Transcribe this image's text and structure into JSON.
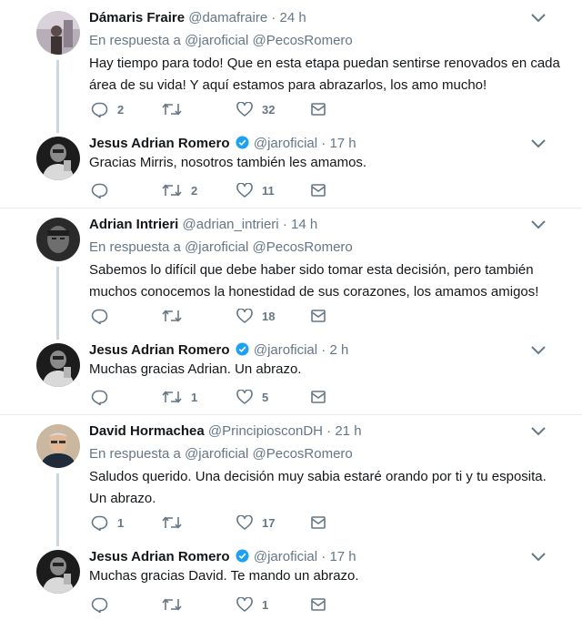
{
  "icons": {
    "reply": "reply-icon",
    "retweet": "retweet-icon",
    "like": "heart-icon",
    "dm": "envelope-icon",
    "more": "chevron-down-icon",
    "verified": "verified-badge-icon"
  },
  "colors": {
    "verified": "#1da1f2",
    "muted": "#657786",
    "line": "#ccd6dd"
  },
  "tweets": [
    {
      "name": "Dámaris Fraire",
      "handle": "@damafraire",
      "time": "24 h",
      "reply_prefix": "En respuesta a",
      "reply_users": "@jaroficial @PecosRomero",
      "text": "Hay tiempo para todo! Que en esta etapa puedan sentirse renovados en cada área de su vida! Y aquí estamos para abrazarlos, los amo mucho!",
      "replies": "2",
      "retweets": "",
      "likes": "32"
    },
    {
      "name": "Jesus Adrian Romero",
      "handle": "@jaroficial",
      "time": "17 h",
      "text": "Gracias Mirris, nosotros también les amamos.",
      "replies": "",
      "retweets": "2",
      "likes": "11"
    },
    {
      "name": "Adrian Intrieri",
      "handle": "@adrian_intrieri",
      "time": "14 h",
      "reply_prefix": "En respuesta a",
      "reply_users": "@jaroficial @PecosRomero",
      "text": "Sabemos lo difícil que debe haber sido tomar esta decisión, pero también muchos conocemos la honestidad de sus corazones, los amamos amigos!",
      "replies": "",
      "retweets": "",
      "likes": "18"
    },
    {
      "name": "Jesus Adrian Romero",
      "handle": "@jaroficial",
      "time": "2 h",
      "text": "Muchas gracias Adrian. Un abrazo.",
      "replies": "",
      "retweets": "1",
      "likes": "5"
    },
    {
      "name": "David Hormachea",
      "handle": "@PrincipiosconDH",
      "time": "21 h",
      "reply_prefix": "En respuesta a",
      "reply_users": "@jaroficial @PecosRomero",
      "text": "Saludos querido. Una decisión muy sabia estaré orando por ti y tu esposita. Un abrazo.",
      "replies": "1",
      "retweets": "",
      "likes": "17"
    },
    {
      "name": "Jesus Adrian Romero",
      "handle": "@jaroficial",
      "time": "17 h",
      "text": "Muchas gracias David. Te mando un abrazo.",
      "replies": "",
      "retweets": "",
      "likes": "1"
    }
  ]
}
